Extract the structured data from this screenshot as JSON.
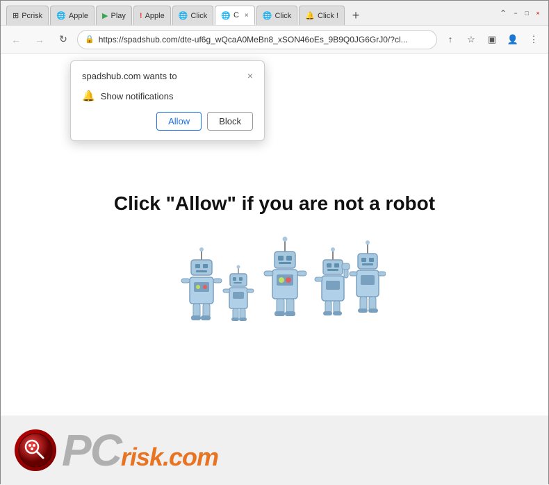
{
  "titlebar": {
    "tabs": [
      {
        "id": "tab1",
        "label": "Pcrisk",
        "favicon": "grid",
        "active": false
      },
      {
        "id": "tab2",
        "label": "Apple",
        "favicon": "globe",
        "active": false
      },
      {
        "id": "tab3",
        "label": "Play",
        "favicon": "circle",
        "active": false
      },
      {
        "id": "tab4",
        "label": "Apple",
        "favicon": "globe-red",
        "active": false
      },
      {
        "id": "tab5",
        "label": "Click",
        "favicon": "globe",
        "active": false
      },
      {
        "id": "tab6",
        "label": "C",
        "favicon": "active-tab",
        "active": true
      },
      {
        "id": "tab7",
        "label": "Click",
        "favicon": "globe-red",
        "active": false
      },
      {
        "id": "tab8",
        "label": "Click !",
        "favicon": "bell",
        "active": false
      }
    ],
    "new_tab_label": "+"
  },
  "window_controls": {
    "minimize": "−",
    "maximize": "□",
    "close": "×"
  },
  "navbar": {
    "back": "←",
    "forward": "→",
    "reload": "↻",
    "url": "https://spadshub.com/dte-uf6g_wQcaA0MeBn8_xSON46oEs_9B9Q0JG6GrJ0/?cl...",
    "share_icon": "↑",
    "bookmark_icon": "☆",
    "profile_icon": "👤",
    "menu_icon": "⋮",
    "extensions_icon": "⚡",
    "sidebar_icon": "▣"
  },
  "popup": {
    "title": "spadshub.com wants to",
    "close_btn": "×",
    "description": "Show notifications",
    "allow_btn": "Allow",
    "block_btn": "Block"
  },
  "page": {
    "main_text": "Click \"Allow\"   if you are not   a robot"
  },
  "footer": {
    "logo_text": "PC",
    "logo_suffix": "risk.com"
  },
  "colors": {
    "allow_blue": "#1a73e8",
    "block_border": "#999",
    "text_dark": "#111",
    "tab_active_bg": "#fff",
    "tab_inactive_bg": "#ddd",
    "nav_bg": "#f8f8f8",
    "pcrisk_orange": "#e87320",
    "pcrisk_grey": "#aaa"
  }
}
